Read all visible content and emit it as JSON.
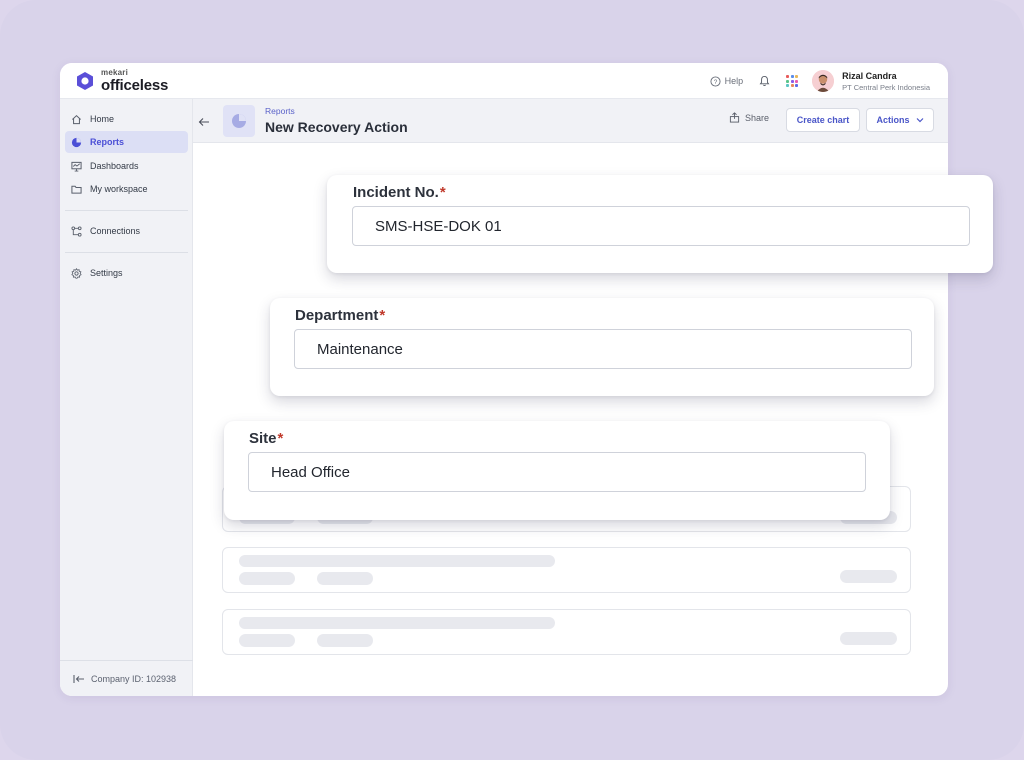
{
  "app": {
    "brand_small": "mekari",
    "brand_name": "officeless",
    "accent": "#5b4fd8"
  },
  "topbar": {
    "help_label": "Help",
    "user_name": "Rizal Candra",
    "user_org": "PT Central Perk Indonesia"
  },
  "sidebar": {
    "items": [
      {
        "label": "Home",
        "icon": "home-icon"
      },
      {
        "label": "Reports",
        "icon": "pie-chart-icon",
        "active": true
      },
      {
        "label": "Dashboards",
        "icon": "monitor-icon"
      },
      {
        "label": "My workspace",
        "icon": "folder-icon"
      },
      {
        "label": "Connections",
        "icon": "connections-icon"
      },
      {
        "label": "Settings",
        "icon": "gear-icon"
      }
    ],
    "company_id": "Company ID: 102938"
  },
  "header": {
    "breadcrumb": "Reports",
    "title": "New Recovery Action",
    "share_label": "Share",
    "create_chart_label": "Create chart",
    "actions_label": "Actions"
  },
  "form": {
    "incident": {
      "label": "Incident No.",
      "required_mark": "*",
      "value": "SMS-HSE-DOK 01"
    },
    "department": {
      "label": "Department",
      "required_mark": "*",
      "value": "Maintenance"
    },
    "site": {
      "label": "Site",
      "required_mark": "*",
      "value": "Head Office"
    }
  }
}
